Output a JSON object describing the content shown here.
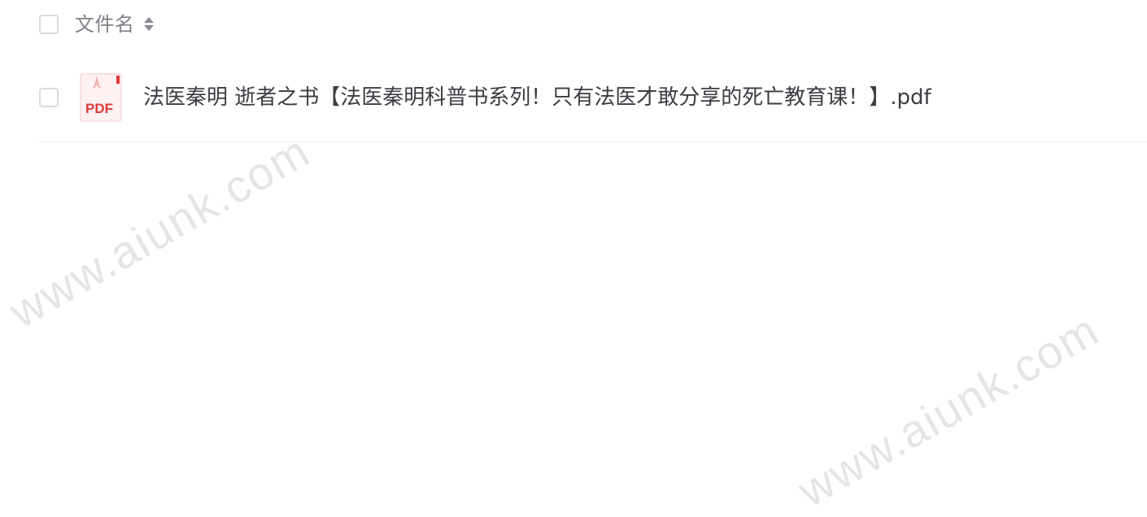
{
  "header": {
    "column_label": "文件名",
    "sort_icon": "sort-icon"
  },
  "files": [
    {
      "name": "法医秦明 逝者之书【法医秦明科普书系列！只有法医才敢分享的死亡教育课！】.pdf",
      "type_icon": "pdf-file-icon",
      "icon_label": "PDF"
    }
  ],
  "watermark": {
    "text": "www.aiunk.com"
  },
  "colors": {
    "pdf_red": "#e0393a",
    "text": "#3b3d42",
    "header_text": "#7f8187"
  }
}
